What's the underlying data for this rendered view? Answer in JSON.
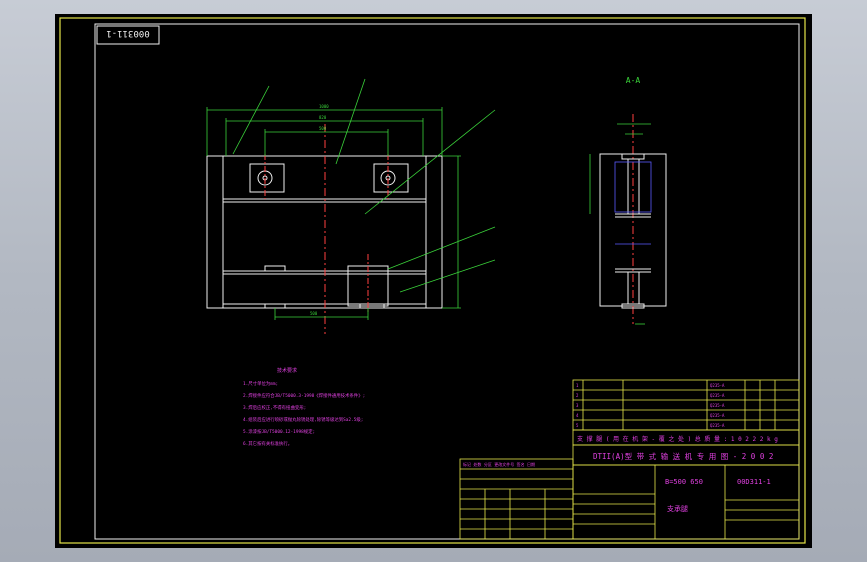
{
  "drawing": {
    "title_stamp": "000311-1",
    "section_label": "A-A",
    "tech_notes": {
      "heading": "技术要求",
      "lines": [
        "1.尺寸单位为mm;",
        "2.焊接件应符合JB/T5000.3-1998《焊接件通用技术条件》;",
        "3.焊后应校正,不得有扭曲变形;",
        "4.组装后应进行喷砂或抛丸除锈处理,除锈等级达到Sa2.5级;",
        "5.涂漆按JB/T5000.12-1998规定;",
        "6.其它按有关标准执行。"
      ]
    },
    "title_block": {
      "header_row": "支 撑 腿   ( 用 在 机 架 - 覆 之 处 )   总 质 量 : 1 0 2 2 2 k g",
      "product": "DTII(A)型  带 式 输 送 机 专 用 图 - 2 0 0 2",
      "spec": "B=500 650",
      "drawing_no": "00D311-1",
      "part_name": "支承腿",
      "revision_header": "标记 处数 分区 更改文件号 签名 日期",
      "revisions": [
        "Q235-A",
        "Q235-A",
        "Q235-A",
        "Q235-A",
        "Q235-A"
      ],
      "parts_list_rows": [
        "1",
        "2",
        "3",
        "4",
        "5"
      ]
    },
    "colors": {
      "frame": "#e6e64a",
      "geometry": "#f0f0f0",
      "dims": "#3ad23a",
      "text": "#e040e0",
      "hidden": "#5a5aff",
      "center": "#ff4040"
    }
  }
}
